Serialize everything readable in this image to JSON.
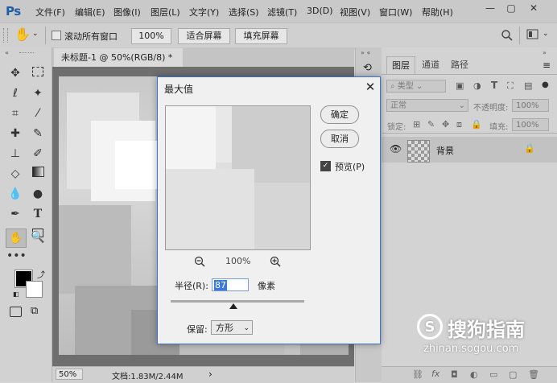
{
  "app": {
    "logo": "Ps"
  },
  "menu": [
    "文件(F)",
    "编辑(E)",
    "图像(I)",
    "图层(L)",
    "文字(Y)",
    "选择(S)",
    "滤镜(T)",
    "3D(D)",
    "视图(V)",
    "窗口(W)",
    "帮助(H)"
  ],
  "window_controls": {
    "minimize": "—",
    "restore": "▢",
    "close": "✕"
  },
  "options_bar": {
    "scroll_all_label": "滚动所有窗口",
    "zoom_100": "100%",
    "fit_screen": "适合屏幕",
    "fill_screen": "填充屏幕"
  },
  "document": {
    "tab_title": "未标题-1 @ 50%(RGB/8) *",
    "tab_close": "×",
    "zoom": "50%",
    "doc_info": "文档:1.83M/2.44M",
    "status_arrow": "›"
  },
  "dialog": {
    "title": "最大值",
    "close": "✕",
    "ok": "确定",
    "cancel": "取消",
    "preview_label": "预览(P)",
    "preview_checked": true,
    "zoom_level": "100%",
    "radius_label": "半径(R):",
    "radius_value": "87",
    "radius_unit": "像素",
    "preserve_label": "保留:",
    "preserve_value": "方形"
  },
  "layers_panel": {
    "tabs": [
      "图层",
      "通道",
      "路径"
    ],
    "filter_kind": "类型",
    "blend_mode": "正常",
    "opacity_label": "不透明度:",
    "opacity_value": "100%",
    "lock_label": "锁定:",
    "fill_label": "填充:",
    "fill_value": "100%",
    "layer_name": "背景"
  },
  "watermark": {
    "brand": "搜狗指南",
    "url": "zhinan.sogou.com"
  },
  "colors": {
    "accent": "#3a76c8",
    "ps_blue": "#1e5fa8",
    "panel": "#d3d3d3",
    "canvas_bg": "#6e6e6e"
  }
}
